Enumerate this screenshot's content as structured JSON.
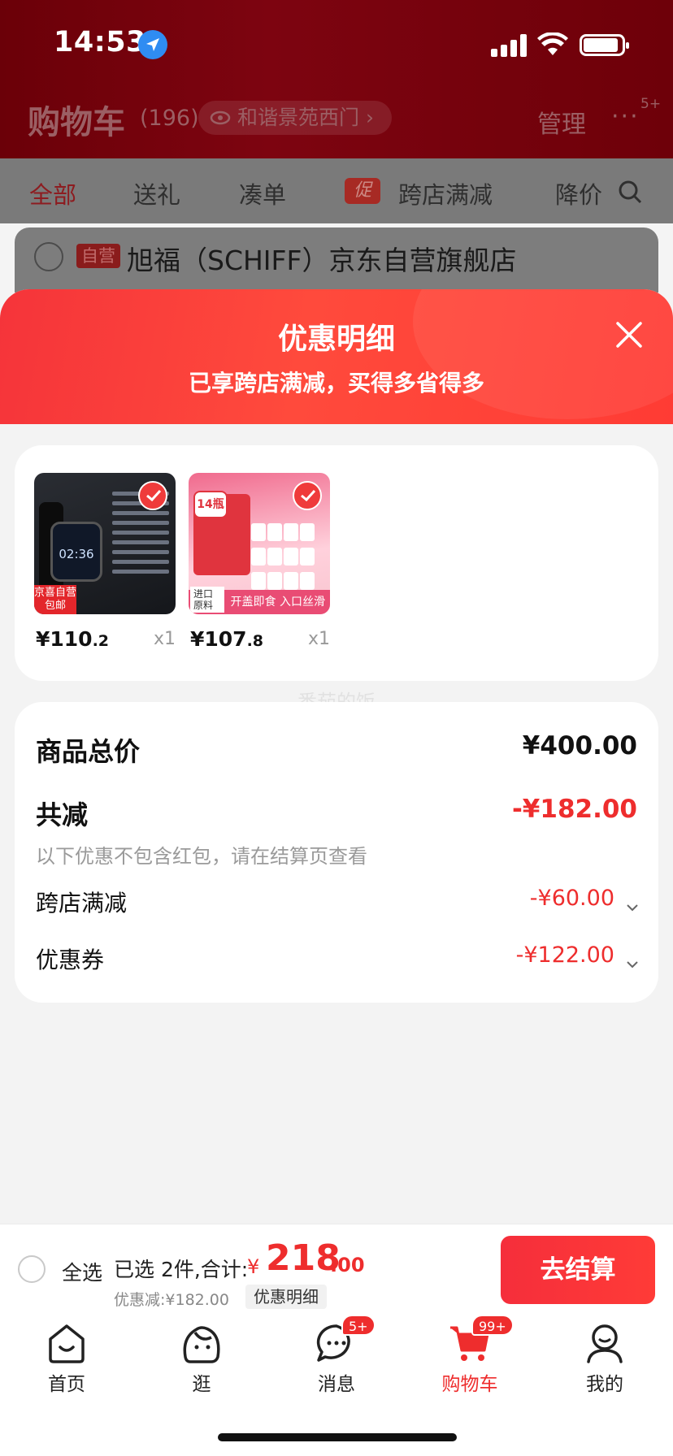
{
  "status_bar": {
    "time": "14:53"
  },
  "header": {
    "title": "购物车",
    "count": "(196)",
    "location": "和谐景苑西门",
    "manage": "管理",
    "more": "···",
    "more_badge": "5+"
  },
  "tabs": [
    {
      "label": "全部",
      "active": true
    },
    {
      "label": "送礼"
    },
    {
      "label": "凑单"
    },
    {
      "label": "跨店满减",
      "promo_tag": "促"
    },
    {
      "label": "降价"
    }
  ],
  "store": {
    "badge": "自营",
    "name": "旭福（SCHIFF）京东自营旗舰店"
  },
  "modal": {
    "title": "优惠明细",
    "subtitle": "已享跨店满减，买得多省得多",
    "products": [
      {
        "price_main": "¥110",
        "price_dec": ".2",
        "qty": "x1",
        "tag_line1": "京喜自营",
        "tag_line2": "包邮",
        "screen_time": "02:36"
      },
      {
        "price_main": "¥107",
        "price_dec": ".8",
        "qty": "x1",
        "tag": "14瓶",
        "band": "开盖即食 入口丝滑",
        "origin_line1": "进口",
        "origin_line2": "原料"
      }
    ],
    "watermark": "番茄的饭",
    "summary": {
      "total_label": "商品总价",
      "total_value": "¥400.00",
      "reduce_label": "共减",
      "reduce_value": "-¥182.00",
      "note": "以下优惠不包含红包，请在结算页查看",
      "cross_label": "跨店满减",
      "cross_value": "-¥60.00",
      "coupon_label": "优惠券",
      "coupon_value": "-¥122.00"
    }
  },
  "bottom_bar": {
    "select_all": "全选",
    "selected_text": "已选 2件,合计:",
    "yen": "¥",
    "total_int": "218",
    "total_dec": ".00",
    "discount_text": "优惠减:¥182.00",
    "detail_link": "优惠明细",
    "checkout": "去结算"
  },
  "tabbar": [
    {
      "label": "首页",
      "icon": "home-icon"
    },
    {
      "label": "逛",
      "icon": "discover-icon"
    },
    {
      "label": "消息",
      "icon": "message-icon",
      "badge": "5+"
    },
    {
      "label": "购物车",
      "icon": "cart-icon",
      "badge": "99+",
      "active": true
    },
    {
      "label": "我的",
      "icon": "profile-icon"
    }
  ],
  "colors": {
    "accent": "#ee2d2d",
    "header_bg": "#6b0008",
    "checkout": "#f52e3b"
  }
}
